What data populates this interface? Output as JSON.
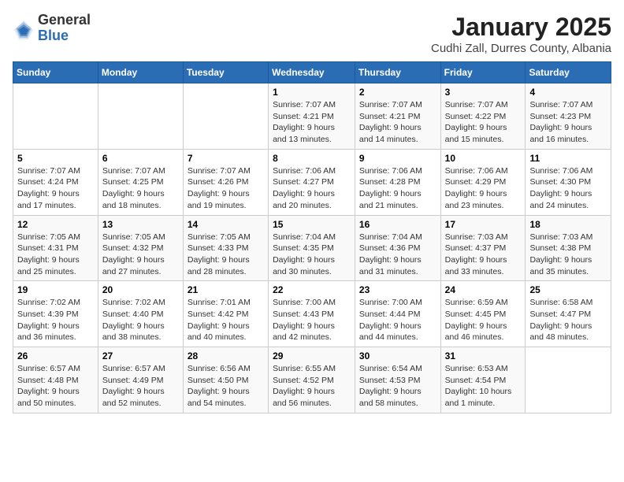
{
  "header": {
    "logo_general": "General",
    "logo_blue": "Blue",
    "month": "January 2025",
    "location": "Cudhi Zall, Durres County, Albania"
  },
  "weekdays": [
    "Sunday",
    "Monday",
    "Tuesday",
    "Wednesday",
    "Thursday",
    "Friday",
    "Saturday"
  ],
  "weeks": [
    [
      {
        "day": "",
        "info": ""
      },
      {
        "day": "",
        "info": ""
      },
      {
        "day": "",
        "info": ""
      },
      {
        "day": "1",
        "info": "Sunrise: 7:07 AM\nSunset: 4:21 PM\nDaylight: 9 hours\nand 13 minutes."
      },
      {
        "day": "2",
        "info": "Sunrise: 7:07 AM\nSunset: 4:21 PM\nDaylight: 9 hours\nand 14 minutes."
      },
      {
        "day": "3",
        "info": "Sunrise: 7:07 AM\nSunset: 4:22 PM\nDaylight: 9 hours\nand 15 minutes."
      },
      {
        "day": "4",
        "info": "Sunrise: 7:07 AM\nSunset: 4:23 PM\nDaylight: 9 hours\nand 16 minutes."
      }
    ],
    [
      {
        "day": "5",
        "info": "Sunrise: 7:07 AM\nSunset: 4:24 PM\nDaylight: 9 hours\nand 17 minutes."
      },
      {
        "day": "6",
        "info": "Sunrise: 7:07 AM\nSunset: 4:25 PM\nDaylight: 9 hours\nand 18 minutes."
      },
      {
        "day": "7",
        "info": "Sunrise: 7:07 AM\nSunset: 4:26 PM\nDaylight: 9 hours\nand 19 minutes."
      },
      {
        "day": "8",
        "info": "Sunrise: 7:06 AM\nSunset: 4:27 PM\nDaylight: 9 hours\nand 20 minutes."
      },
      {
        "day": "9",
        "info": "Sunrise: 7:06 AM\nSunset: 4:28 PM\nDaylight: 9 hours\nand 21 minutes."
      },
      {
        "day": "10",
        "info": "Sunrise: 7:06 AM\nSunset: 4:29 PM\nDaylight: 9 hours\nand 23 minutes."
      },
      {
        "day": "11",
        "info": "Sunrise: 7:06 AM\nSunset: 4:30 PM\nDaylight: 9 hours\nand 24 minutes."
      }
    ],
    [
      {
        "day": "12",
        "info": "Sunrise: 7:05 AM\nSunset: 4:31 PM\nDaylight: 9 hours\nand 25 minutes."
      },
      {
        "day": "13",
        "info": "Sunrise: 7:05 AM\nSunset: 4:32 PM\nDaylight: 9 hours\nand 27 minutes."
      },
      {
        "day": "14",
        "info": "Sunrise: 7:05 AM\nSunset: 4:33 PM\nDaylight: 9 hours\nand 28 minutes."
      },
      {
        "day": "15",
        "info": "Sunrise: 7:04 AM\nSunset: 4:35 PM\nDaylight: 9 hours\nand 30 minutes."
      },
      {
        "day": "16",
        "info": "Sunrise: 7:04 AM\nSunset: 4:36 PM\nDaylight: 9 hours\nand 31 minutes."
      },
      {
        "day": "17",
        "info": "Sunrise: 7:03 AM\nSunset: 4:37 PM\nDaylight: 9 hours\nand 33 minutes."
      },
      {
        "day": "18",
        "info": "Sunrise: 7:03 AM\nSunset: 4:38 PM\nDaylight: 9 hours\nand 35 minutes."
      }
    ],
    [
      {
        "day": "19",
        "info": "Sunrise: 7:02 AM\nSunset: 4:39 PM\nDaylight: 9 hours\nand 36 minutes."
      },
      {
        "day": "20",
        "info": "Sunrise: 7:02 AM\nSunset: 4:40 PM\nDaylight: 9 hours\nand 38 minutes."
      },
      {
        "day": "21",
        "info": "Sunrise: 7:01 AM\nSunset: 4:42 PM\nDaylight: 9 hours\nand 40 minutes."
      },
      {
        "day": "22",
        "info": "Sunrise: 7:00 AM\nSunset: 4:43 PM\nDaylight: 9 hours\nand 42 minutes."
      },
      {
        "day": "23",
        "info": "Sunrise: 7:00 AM\nSunset: 4:44 PM\nDaylight: 9 hours\nand 44 minutes."
      },
      {
        "day": "24",
        "info": "Sunrise: 6:59 AM\nSunset: 4:45 PM\nDaylight: 9 hours\nand 46 minutes."
      },
      {
        "day": "25",
        "info": "Sunrise: 6:58 AM\nSunset: 4:47 PM\nDaylight: 9 hours\nand 48 minutes."
      }
    ],
    [
      {
        "day": "26",
        "info": "Sunrise: 6:57 AM\nSunset: 4:48 PM\nDaylight: 9 hours\nand 50 minutes."
      },
      {
        "day": "27",
        "info": "Sunrise: 6:57 AM\nSunset: 4:49 PM\nDaylight: 9 hours\nand 52 minutes."
      },
      {
        "day": "28",
        "info": "Sunrise: 6:56 AM\nSunset: 4:50 PM\nDaylight: 9 hours\nand 54 minutes."
      },
      {
        "day": "29",
        "info": "Sunrise: 6:55 AM\nSunset: 4:52 PM\nDaylight: 9 hours\nand 56 minutes."
      },
      {
        "day": "30",
        "info": "Sunrise: 6:54 AM\nSunset: 4:53 PM\nDaylight: 9 hours\nand 58 minutes."
      },
      {
        "day": "31",
        "info": "Sunrise: 6:53 AM\nSunset: 4:54 PM\nDaylight: 10 hours\nand 1 minute."
      },
      {
        "day": "",
        "info": ""
      }
    ]
  ]
}
